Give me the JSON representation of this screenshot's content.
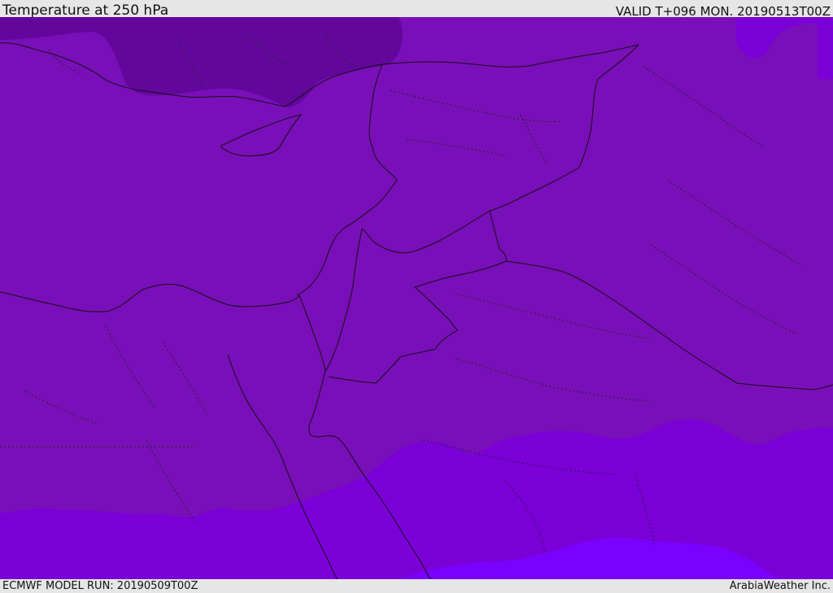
{
  "header": {
    "title": "Temperature at 250 hPa",
    "valid": "VALID T+096 MON. 20190513T00Z"
  },
  "footer": {
    "model_run": "ECMWF MODEL RUN: 20190509T00Z",
    "credit": "ArabiaWeather Inc."
  },
  "map": {
    "region": "Eastern Mediterranean and Middle East",
    "field": "250 hPa temperature shading",
    "colors": {
      "coldest": "#5e0394",
      "cold": "#7a0fb8",
      "mid": "#790fbe",
      "warm": "#7b00d8",
      "warmest": "#7a00ff"
    }
  }
}
